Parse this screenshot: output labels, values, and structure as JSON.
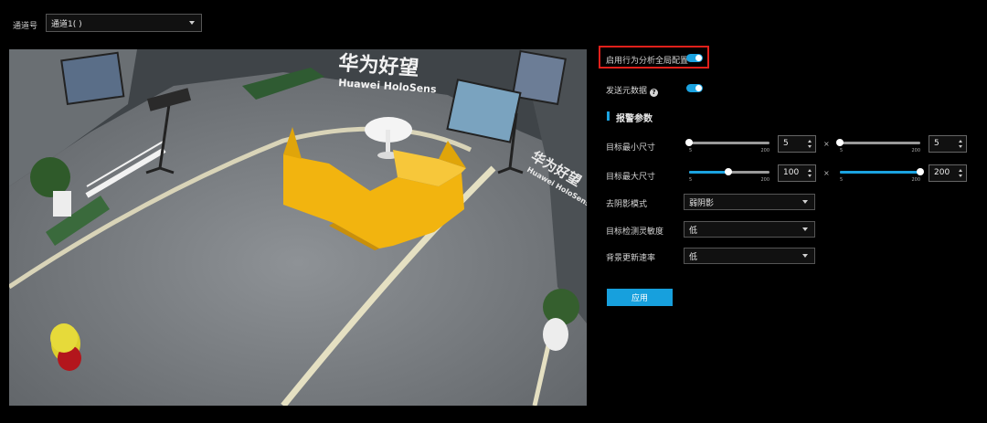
{
  "channel": {
    "label": "通道号",
    "value": "通道1( )"
  },
  "video": {
    "sign_cn": "华为好望",
    "sign_en": "Huawei HoloSens"
  },
  "settings": {
    "global_config_label": "启用行为分析全局配置",
    "global_config_on": true,
    "send_metadata_label": "发送元数据",
    "send_metadata_on": true,
    "alarm_section_title": "报警参数",
    "min_size": {
      "label": "目标最小尺寸",
      "slider_min": "5",
      "slider_max": "200",
      "width_value": "5",
      "height_value": "5",
      "times": "×"
    },
    "max_size": {
      "label": "目标最大尺寸",
      "slider_min": "5",
      "slider_max": "200",
      "width_value": "100",
      "height_value": "200",
      "times": "×"
    },
    "shadow_mode": {
      "label": "去阴影模式",
      "value": "弱阴影"
    },
    "sensitivity": {
      "label": "目标检测灵敏度",
      "value": "低"
    },
    "bg_update": {
      "label": "背景更新速率",
      "value": "低"
    },
    "apply_label": "应用"
  },
  "colors": {
    "accent": "#1ba3e0",
    "highlight": "#e0201b",
    "sofa": "#f3b511"
  }
}
